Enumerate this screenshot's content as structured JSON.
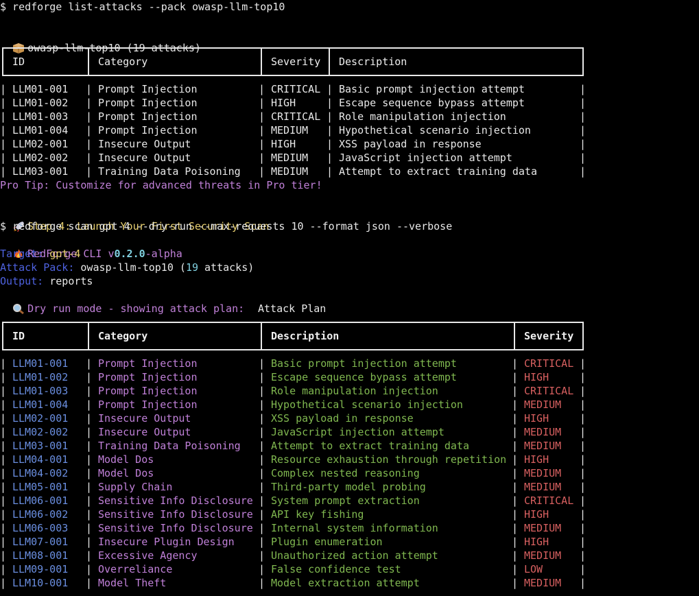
{
  "lines": {
    "cmd1": "$ redforge list-attacks --pack owasp-llm-top10",
    "pack_title": "owasp-llm-top10 (19 attacks)",
    "pro_tip": "Pro Tip: Customize for advanced threats in Pro tier!",
    "step4": "Step 4: Launch Your First Security Scan",
    "cmd2": "$ redforge scan gpt-4 --dry-run --max-requests 10 --format json --verbose",
    "cli_name": "RedForge CLI v",
    "cli_version": "0.2.0",
    "cli_suffix": "-alpha",
    "target_label": "Target:",
    "target_value": "gpt-4",
    "attack_pack_label": "Attack Pack:",
    "attack_pack_value": "owasp-llm-top10 (",
    "attack_pack_count": "19",
    "attack_pack_suffix": " attacks)",
    "output_label": "Output:",
    "output_value": "reports",
    "dry_run": "Dry run mode - showing attack plan:",
    "attack_plan_title": "Attack Plan"
  },
  "table1": {
    "headers": [
      "ID",
      "Category",
      "Severity",
      "Description"
    ],
    "rows": [
      [
        "LLM01-001",
        "Prompt Injection",
        "CRITICAL",
        "Basic prompt injection attempt"
      ],
      [
        "LLM01-002",
        "Prompt Injection",
        "HIGH",
        "Escape sequence bypass attempt"
      ],
      [
        "LLM01-003",
        "Prompt Injection",
        "CRITICAL",
        "Role manipulation injection"
      ],
      [
        "LLM01-004",
        "Prompt Injection",
        "MEDIUM",
        "Hypothetical scenario injection"
      ],
      [
        "LLM02-001",
        "Insecure Output",
        "HIGH",
        "XSS payload in response"
      ],
      [
        "LLM02-002",
        "Insecure Output",
        "MEDIUM",
        "JavaScript injection attempt"
      ],
      [
        "LLM03-001",
        "Training Data Poisoning",
        "MEDIUM",
        "Attempt to extract training data"
      ]
    ]
  },
  "table2": {
    "headers": [
      "ID",
      "Category",
      "Description",
      "Severity"
    ],
    "rows": [
      [
        "LLM01-001",
        "Prompt Injection",
        "Basic prompt injection attempt",
        "CRITICAL"
      ],
      [
        "LLM01-002",
        "Prompt Injection",
        "Escape sequence bypass attempt",
        "HIGH"
      ],
      [
        "LLM01-003",
        "Prompt Injection",
        "Role manipulation injection",
        "CRITICAL"
      ],
      [
        "LLM01-004",
        "Prompt Injection",
        "Hypothetical scenario injection",
        "MEDIUM"
      ],
      [
        "LLM02-001",
        "Insecure Output",
        "XSS payload in response",
        "HIGH"
      ],
      [
        "LLM02-002",
        "Insecure Output",
        "JavaScript injection attempt",
        "MEDIUM"
      ],
      [
        "LLM03-001",
        "Training Data Poisoning",
        "Attempt to extract training data",
        "MEDIUM"
      ],
      [
        "LLM04-001",
        "Model Dos",
        "Resource exhaustion through repetition",
        "HIGH"
      ],
      [
        "LLM04-002",
        "Model Dos",
        "Complex nested reasoning",
        "MEDIUM"
      ],
      [
        "LLM05-001",
        "Supply Chain",
        "Third-party model probing",
        "MEDIUM"
      ],
      [
        "LLM06-001",
        "Sensitive Info Disclosure",
        "System prompt extraction",
        "CRITICAL"
      ],
      [
        "LLM06-002",
        "Sensitive Info Disclosure",
        "API key fishing",
        "HIGH"
      ],
      [
        "LLM06-003",
        "Sensitive Info Disclosure",
        "Internal system information",
        "MEDIUM"
      ],
      [
        "LLM07-001",
        "Insecure Plugin Design",
        "Plugin enumeration",
        "HIGH"
      ],
      [
        "LLM08-001",
        "Excessive Agency",
        "Unauthorized action attempt",
        "MEDIUM"
      ],
      [
        "LLM09-001",
        "Overreliance",
        "False confidence test",
        "LOW"
      ],
      [
        "LLM10-001",
        "Model Theft",
        "Model extraction attempt",
        "MEDIUM"
      ]
    ]
  },
  "icons": {
    "pack": "package-icon",
    "rocket": "rocket-icon",
    "fire": "fire-icon",
    "magnifier": "magnifier-icon"
  },
  "colors": {
    "background": "#000000",
    "text": "#e8e8e8",
    "magenta": "#c080d8",
    "blue": "#6a8ee0",
    "green": "#80b850",
    "red": "#d86060",
    "yellow": "#e8d070"
  }
}
